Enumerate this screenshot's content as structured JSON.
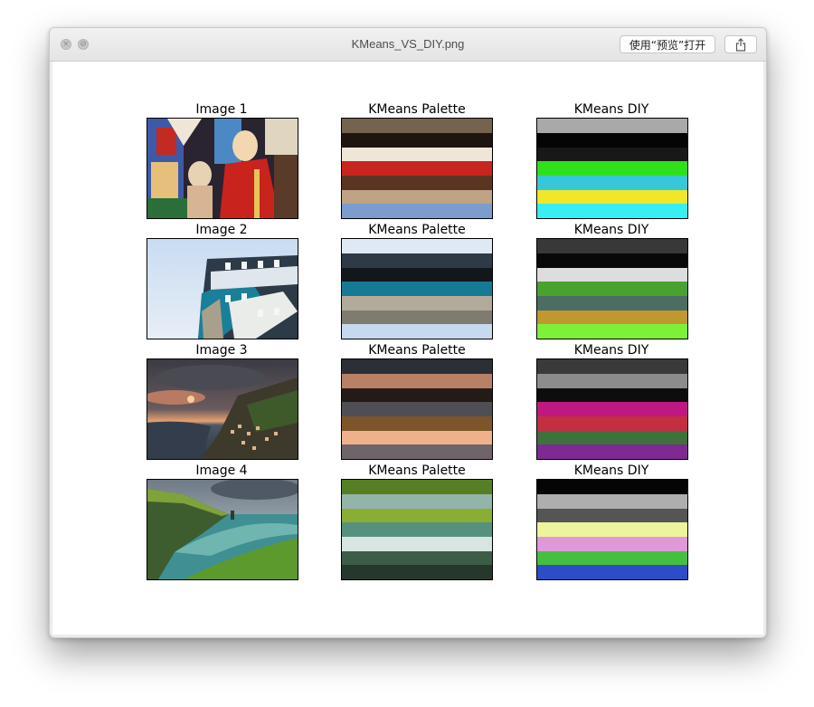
{
  "window": {
    "title": "KMeans_VS_DIY.png",
    "open_button_label": "使用“预览”打开",
    "share_icon": "share-icon"
  },
  "figure": {
    "rows": [
      {
        "image_title": "Image 1",
        "palette_title": "KMeans Palette",
        "diy_title": "KMeans DIY",
        "image_desc": "stained-glass-saints",
        "palette_colors": [
          "#75624f",
          "#1e1510",
          "#efe6d8",
          "#c8251e",
          "#5a3522",
          "#bea385",
          "#7b9ccc"
        ],
        "diy_colors": [
          "#a9a9a9",
          "#050505",
          "#181818",
          "#2ee01a",
          "#36c8d8",
          "#f0e62a",
          "#37eef5"
        ]
      },
      {
        "image_title": "Image 2",
        "palette_title": "KMeans Palette",
        "diy_title": "KMeans DIY",
        "image_desc": "building-against-sky",
        "palette_colors": [
          "#dfe9f5",
          "#2e3a46",
          "#12171c",
          "#167a94",
          "#b2ab9b",
          "#7f7b70",
          "#c7d9ef"
        ],
        "diy_colors": [
          "#383838",
          "#080808",
          "#dddddd",
          "#49a230",
          "#4b6d62",
          "#c1982f",
          "#7df139"
        ]
      },
      {
        "image_title": "Image 3",
        "palette_title": "KMeans Palette",
        "diy_title": "KMeans DIY",
        "image_desc": "coastal-village-sunset",
        "palette_colors": [
          "#2d2f36",
          "#b98068",
          "#241b16",
          "#4f4e55",
          "#7d5529",
          "#efb18b",
          "#6e6469"
        ],
        "diy_colors": [
          "#3a3a3a",
          "#8c8c8c",
          "#0d0d0d",
          "#c01883",
          "#c42e42",
          "#3e723d",
          "#7e2a92"
        ]
      },
      {
        "image_title": "Image 4",
        "palette_title": "KMeans Palette",
        "diy_title": "KMeans DIY",
        "image_desc": "sea-cliffs",
        "palette_colors": [
          "#567f22",
          "#93b4a8",
          "#8aae33",
          "#56917f",
          "#d8e5e1",
          "#3e5d48",
          "#26382c"
        ],
        "diy_colors": [
          "#050505",
          "#aeaeae",
          "#555555",
          "#eef39e",
          "#df99d9",
          "#45bf3f",
          "#2d4dc7"
        ]
      }
    ]
  }
}
